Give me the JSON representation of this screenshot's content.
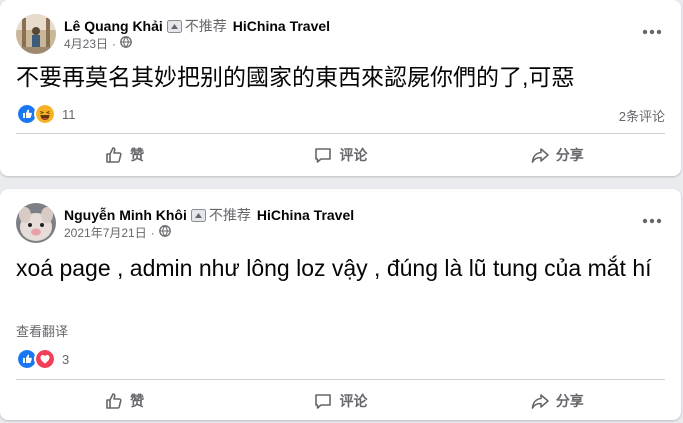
{
  "colors": {
    "accent": "#1877f2",
    "muted": "#65676b",
    "love": "#f33e58",
    "haha": "#f7b125"
  },
  "posts": [
    {
      "author": "Lê Quang Khải",
      "tag_icon": "tag-icon",
      "tag": "不推荐",
      "group": "HiChina Travel",
      "date": "4月23日",
      "dot": "·",
      "privacy_icon": "globe-icon",
      "text": "不要再莫名其妙把别的國家的東西來認屍你們的了,可惡",
      "reaction_icons": [
        "like-icon",
        "haha-icon"
      ],
      "reaction_count": "11",
      "comment_count": "2条评论",
      "actions": {
        "like": "赞",
        "comment": "评论",
        "share": "分享"
      }
    },
    {
      "author": "Nguyễn Minh Khôi",
      "tag_icon": "tag-icon",
      "tag": "不推荐",
      "group": "HiChina Travel",
      "date": "2021年7月21日",
      "dot": "·",
      "privacy_icon": "globe-icon",
      "text": "xoá page , admin như lông loz vậy , đúng là lũ tung của mắt hí",
      "see_translation": "查看翻译",
      "reaction_icons": [
        "like-icon",
        "love-icon"
      ],
      "reaction_count": "3",
      "actions": {
        "like": "赞",
        "comment": "评论",
        "share": "分享"
      }
    }
  ]
}
